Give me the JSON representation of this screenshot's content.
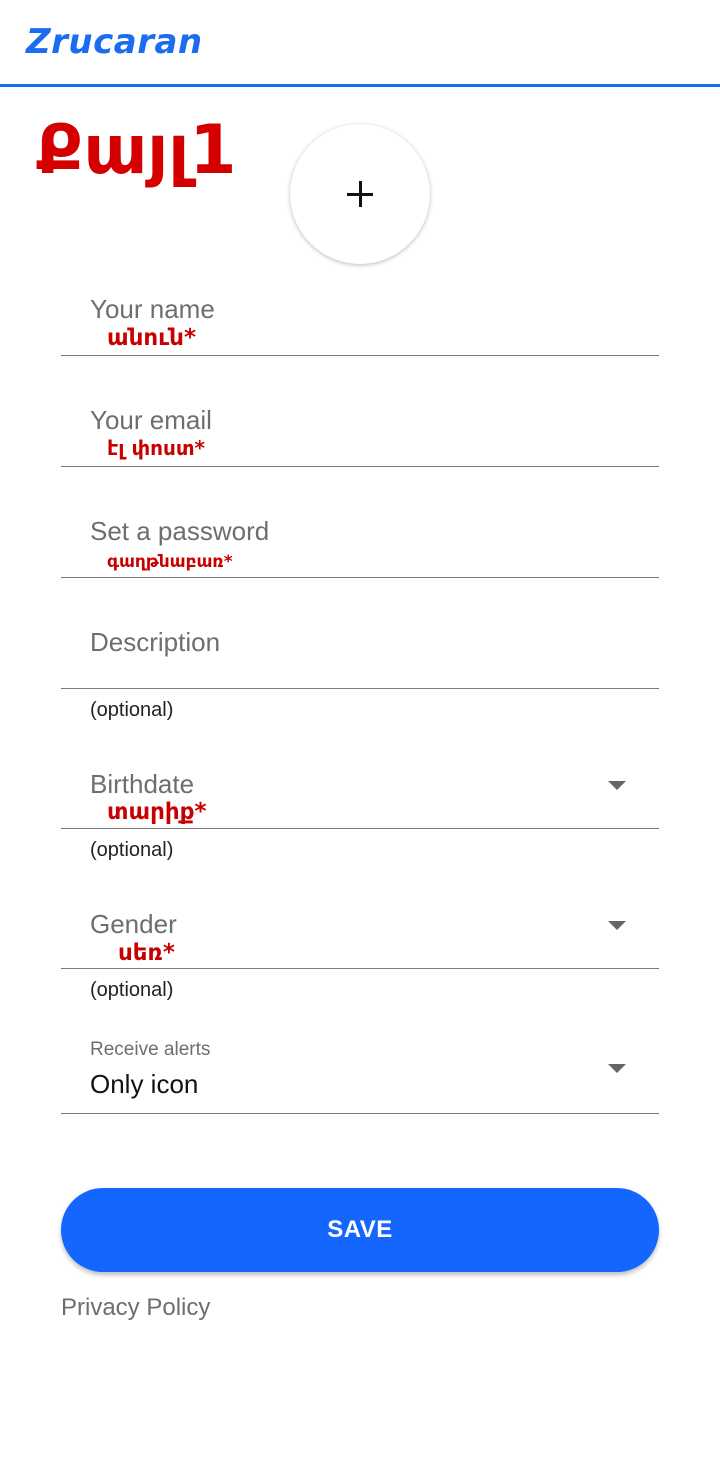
{
  "header": {
    "logo_text": "Zrucaran",
    "accent_color": "#1a6cf0"
  },
  "step": {
    "title": "Քայլ1"
  },
  "avatar": {
    "add_icon": "plus-icon"
  },
  "form": {
    "name": {
      "label": "Your name",
      "hint": "անուն*"
    },
    "email": {
      "label": "Your email",
      "hint": "էլ փոստ*"
    },
    "password": {
      "label": "Set a password",
      "hint": "գաղթնաբառ*"
    },
    "description": {
      "label": "Description",
      "helper": "(optional)"
    },
    "birthdate": {
      "label": "Birthdate",
      "hint": "տարիք*",
      "helper": "(optional)"
    },
    "gender": {
      "label": "Gender",
      "hint": "սեռ*",
      "helper": "(optional)"
    },
    "alerts": {
      "label": "Receive alerts",
      "value": "Only icon"
    }
  },
  "actions": {
    "save_label": "SAVE",
    "privacy_label": "Privacy Policy",
    "button_color": "#1565ff"
  },
  "hint_color": "#c80000"
}
